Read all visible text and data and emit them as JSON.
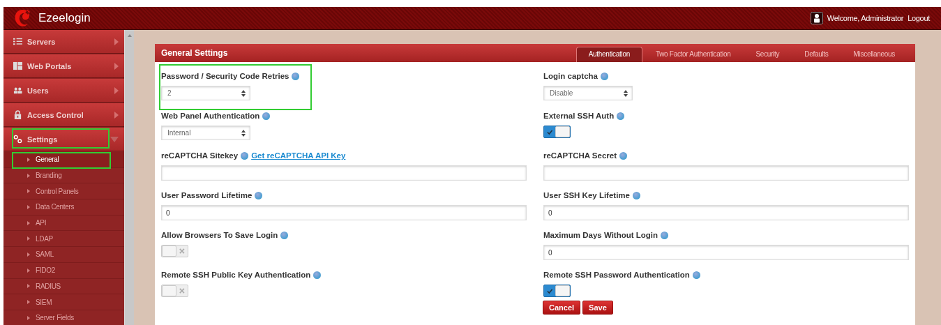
{
  "header": {
    "app_name": "Ezeelogin",
    "welcome": "Welcome, Administrator",
    "logout": "Logout"
  },
  "sidebar": {
    "items": [
      {
        "label": "Servers",
        "expanded": false,
        "highlighted": false
      },
      {
        "label": "Web Portals",
        "expanded": false,
        "highlighted": false
      },
      {
        "label": "Users",
        "expanded": false,
        "highlighted": false
      },
      {
        "label": "Access Control",
        "expanded": false,
        "highlighted": false
      },
      {
        "label": "Settings",
        "expanded": true,
        "highlighted": true,
        "children": [
          {
            "label": "General",
            "selected": true,
            "highlighted": true
          },
          {
            "label": "Branding",
            "selected": false,
            "highlighted": false
          },
          {
            "label": "Control Panels",
            "selected": false,
            "highlighted": false
          },
          {
            "label": "Data Centers",
            "selected": false,
            "highlighted": false
          },
          {
            "label": "API",
            "selected": false,
            "highlighted": false
          },
          {
            "label": "LDAP",
            "selected": false,
            "highlighted": false
          },
          {
            "label": "SAML",
            "selected": false,
            "highlighted": false
          },
          {
            "label": "FIDO2",
            "selected": false,
            "highlighted": false
          },
          {
            "label": "RADIUS",
            "selected": false,
            "highlighted": false
          },
          {
            "label": "SIEM",
            "selected": false,
            "highlighted": false
          },
          {
            "label": "Server Fields",
            "selected": false,
            "highlighted": false
          }
        ]
      }
    ]
  },
  "panel": {
    "title": "General Settings",
    "tabs": [
      {
        "label": "Authentication",
        "selected": true
      },
      {
        "label": "Two Factor Authentication",
        "selected": false
      },
      {
        "label": "Security",
        "selected": false
      },
      {
        "label": "Defaults",
        "selected": false
      },
      {
        "label": "Miscellaneous",
        "selected": false
      }
    ],
    "rows": [
      [
        {
          "label": "Password / Security Code Retries",
          "kind": "select",
          "value": "2",
          "highlighted": true
        },
        {
          "label": "Login captcha",
          "kind": "select",
          "value": "Disable",
          "highlighted": false
        }
      ],
      [
        {
          "label": "Web Panel Authentication",
          "kind": "select",
          "value": "Internal",
          "highlighted": false
        },
        {
          "label": "External SSH Auth",
          "kind": "toggle",
          "on": true,
          "highlighted": false
        }
      ],
      [
        {
          "label": "reCAPTCHA Sitekey",
          "kind": "text",
          "link": "Get reCAPTCHA API Key",
          "highlighted": false
        },
        {
          "label": "reCAPTCHA Secret",
          "kind": "text",
          "highlighted": false
        }
      ],
      [
        {
          "label": "User Password Lifetime",
          "kind": "text",
          "value": "0",
          "highlighted": false
        },
        {
          "label": "User SSH Key Lifetime",
          "kind": "text",
          "value": "0",
          "highlighted": false
        }
      ],
      [
        {
          "label": "Allow Browsers To Save Login",
          "kind": "toggle",
          "on": false,
          "highlighted": false
        },
        {
          "label": "Maximum Days Without Login",
          "kind": "text",
          "value": "0",
          "highlighted": false
        }
      ],
      [
        {
          "label": "Remote SSH Public Key Authentication",
          "kind": "toggle",
          "on": false,
          "highlighted": false
        },
        {
          "label": "Remote SSH Password Authentication",
          "kind": "toggle",
          "on": true,
          "highlighted": false
        }
      ]
    ],
    "buttons": [
      "Cancel",
      "Save"
    ]
  }
}
